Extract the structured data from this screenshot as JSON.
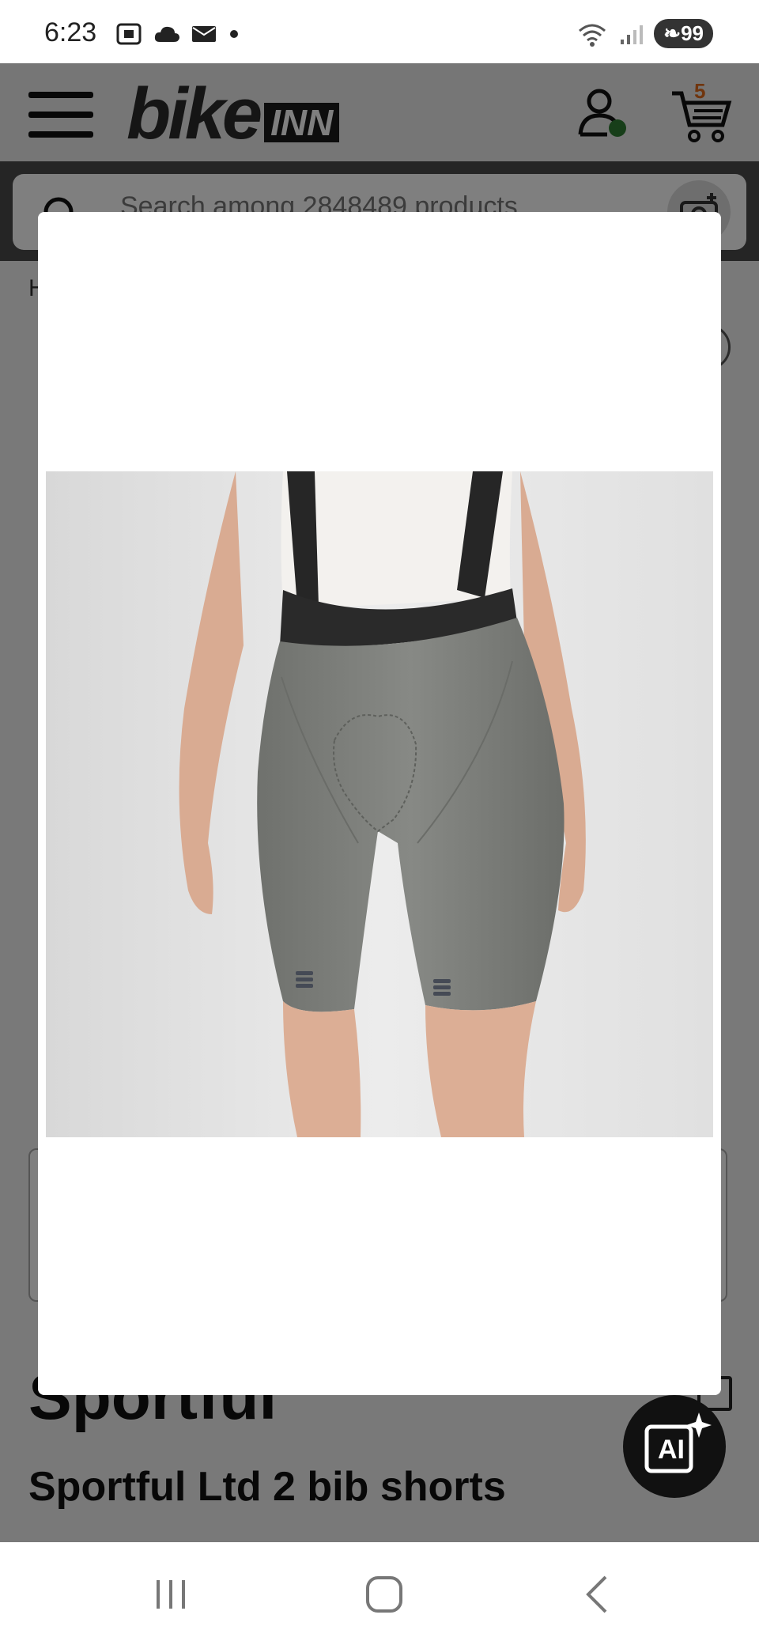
{
  "status_bar": {
    "time": "6:23",
    "battery": "99",
    "icons": [
      "screenshot-icon",
      "cloud-icon",
      "mail-icon",
      "dot-icon",
      "wifi-icon",
      "signal-icon"
    ]
  },
  "header": {
    "logo_bike": "bike",
    "logo_inn": "INN",
    "cart_count": "5",
    "icons": [
      "menu-icon",
      "user-icon",
      "cart-icon"
    ]
  },
  "search": {
    "placeholder": "Search among 2848489 products"
  },
  "breadcrumb": {
    "text": "H"
  },
  "product": {
    "brand": "Sportful",
    "title": "Sportful Ltd 2 bib shorts"
  },
  "modal": {
    "image_alt": "Sportful Ltd 2 bib shorts product image"
  },
  "ai_button": {
    "label": "AI"
  },
  "colors": {
    "accent_cart": "#e06a1b",
    "online_dot": "#2e7d32",
    "shorts": "#7d7f7b",
    "straps": "#222222"
  }
}
